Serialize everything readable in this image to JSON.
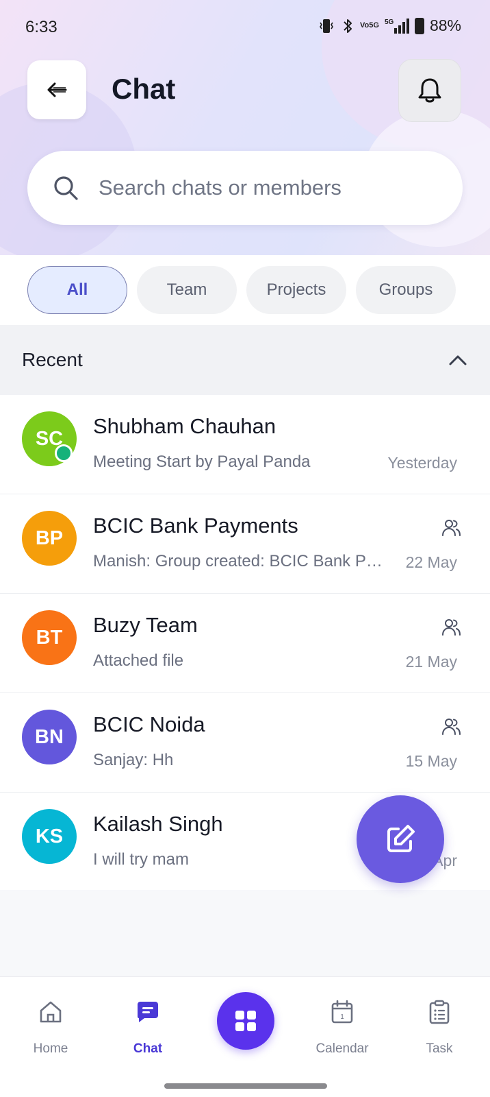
{
  "status_bar": {
    "time": "6:33",
    "network_top": "Vo",
    "network_bottom": "5G",
    "signal_label": "5G",
    "battery": "88%"
  },
  "header": {
    "title": "Chat"
  },
  "search": {
    "placeholder": "Search chats or members",
    "value": ""
  },
  "filters": [
    {
      "label": "All",
      "active": true
    },
    {
      "label": "Team",
      "active": false
    },
    {
      "label": "Projects",
      "active": false
    },
    {
      "label": "Groups",
      "active": false
    }
  ],
  "section": {
    "title": "Recent",
    "expanded": true
  },
  "chats": [
    {
      "initials": "SC",
      "name": "Shubham Chauhan",
      "message": "Meeting  Start by Payal Panda",
      "time": "Yesterday",
      "avatar_color": "#7ccb1b",
      "online": true,
      "group": false
    },
    {
      "initials": "BP",
      "name": "BCIC Bank Payments",
      "message": "Manish: Group created: BCIC Bank Payments",
      "time": "22 May",
      "avatar_color": "#f59e0b",
      "online": false,
      "group": true
    },
    {
      "initials": "BT",
      "name": "Buzy Team",
      "message": "Attached file",
      "time": "21 May",
      "avatar_color": "#f97316",
      "online": false,
      "group": true
    },
    {
      "initials": "BN",
      "name": "BCIC Noida",
      "message": "Sanjay: Hh",
      "time": "15 May",
      "avatar_color": "#6357dc",
      "online": false,
      "group": true
    },
    {
      "initials": "KS",
      "name": "Kailash Singh",
      "message": "I will try mam",
      "time": "Apr",
      "avatar_color": "#06b6d4",
      "online": false,
      "group": false
    }
  ],
  "nav": {
    "home": "Home",
    "chat": "Chat",
    "calendar": "Calendar",
    "task": "Task",
    "calendar_day": "1"
  },
  "colors": {
    "accent": "#5a32ec",
    "fab": "#6a5ae0",
    "active_chip_bg": "#e5ecff"
  },
  "icons": [
    "back-arrow-icon",
    "bell-icon",
    "search-icon",
    "chevron-up-icon",
    "group-icon",
    "edit-icon",
    "home-icon",
    "chat-icon",
    "grid-icon",
    "calendar-icon",
    "task-icon"
  ]
}
